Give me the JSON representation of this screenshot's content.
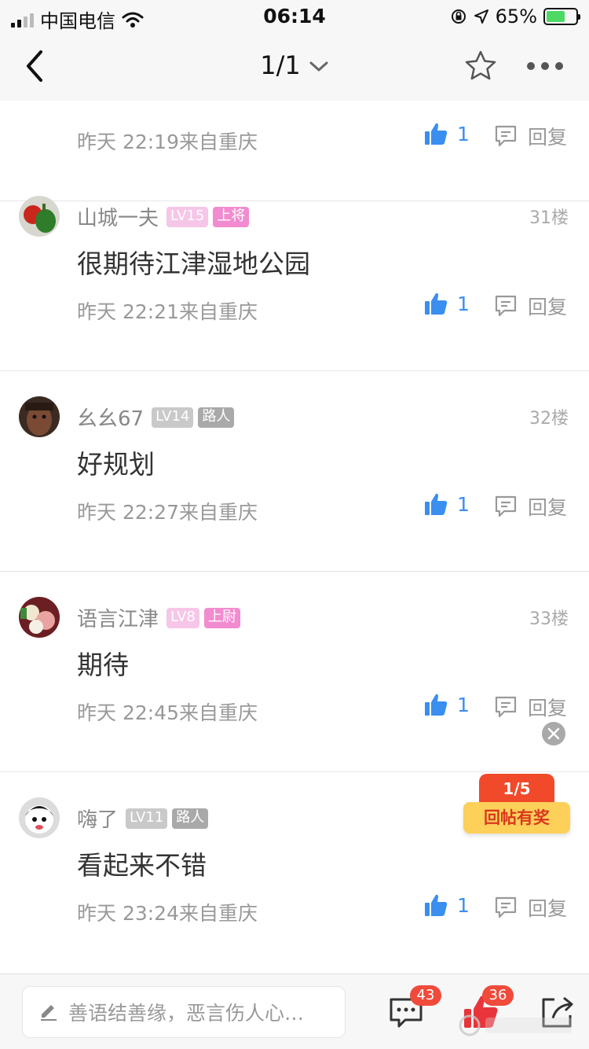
{
  "status_bar": {
    "carrier": "中国电信",
    "time": "06:14",
    "battery_percent": "65%",
    "battery_level": 0.65
  },
  "nav": {
    "page_indicator": "1/1",
    "icons": [
      "back-arrow-icon",
      "chevron-down-icon",
      "star-icon",
      "more-icon"
    ]
  },
  "top_partial_post": {
    "meta": "昨天 22:19来自重庆",
    "likes": "1",
    "reply_label": "回复"
  },
  "posts": [
    {
      "username": "山城一夫",
      "level": "LV15",
      "rank": "上将",
      "floor": "31楼",
      "text": "很期待江津湿地公园",
      "meta": "昨天 22:21来自重庆",
      "likes": "1",
      "reply_label": "回复",
      "badge_style": "pink"
    },
    {
      "username": "幺幺67",
      "level": "LV14",
      "rank": "路人",
      "floor": "32楼",
      "text": "好规划",
      "meta": "昨天 22:27来自重庆",
      "likes": "1",
      "reply_label": "回复",
      "badge_style": "gray"
    },
    {
      "username": "语言江津",
      "level": "LV8",
      "rank": "上尉",
      "floor": "33楼",
      "text": "期待",
      "meta": "昨天 22:45来自重庆",
      "likes": "1",
      "reply_label": "回复",
      "badge_style": "pink"
    },
    {
      "username": "嗨了",
      "level": "LV11",
      "rank": "路人",
      "floor": "",
      "text": "看起来不错",
      "meta": "昨天 23:24来自重庆",
      "likes": "1",
      "reply_label": "回复",
      "badge_style": "gray"
    }
  ],
  "reward": {
    "count": "1/5",
    "label": "回帖有奖"
  },
  "bottom_bar": {
    "input_placeholder": "善语结善缘，恶言伤人心…",
    "comments_count": "43",
    "likes_count": "36"
  },
  "colors": {
    "like_blue": "#3a8ef0",
    "badge_red": "#f04a3a",
    "rank_pink": "#f28bcf",
    "reward_yellow": "#fdd05a"
  }
}
